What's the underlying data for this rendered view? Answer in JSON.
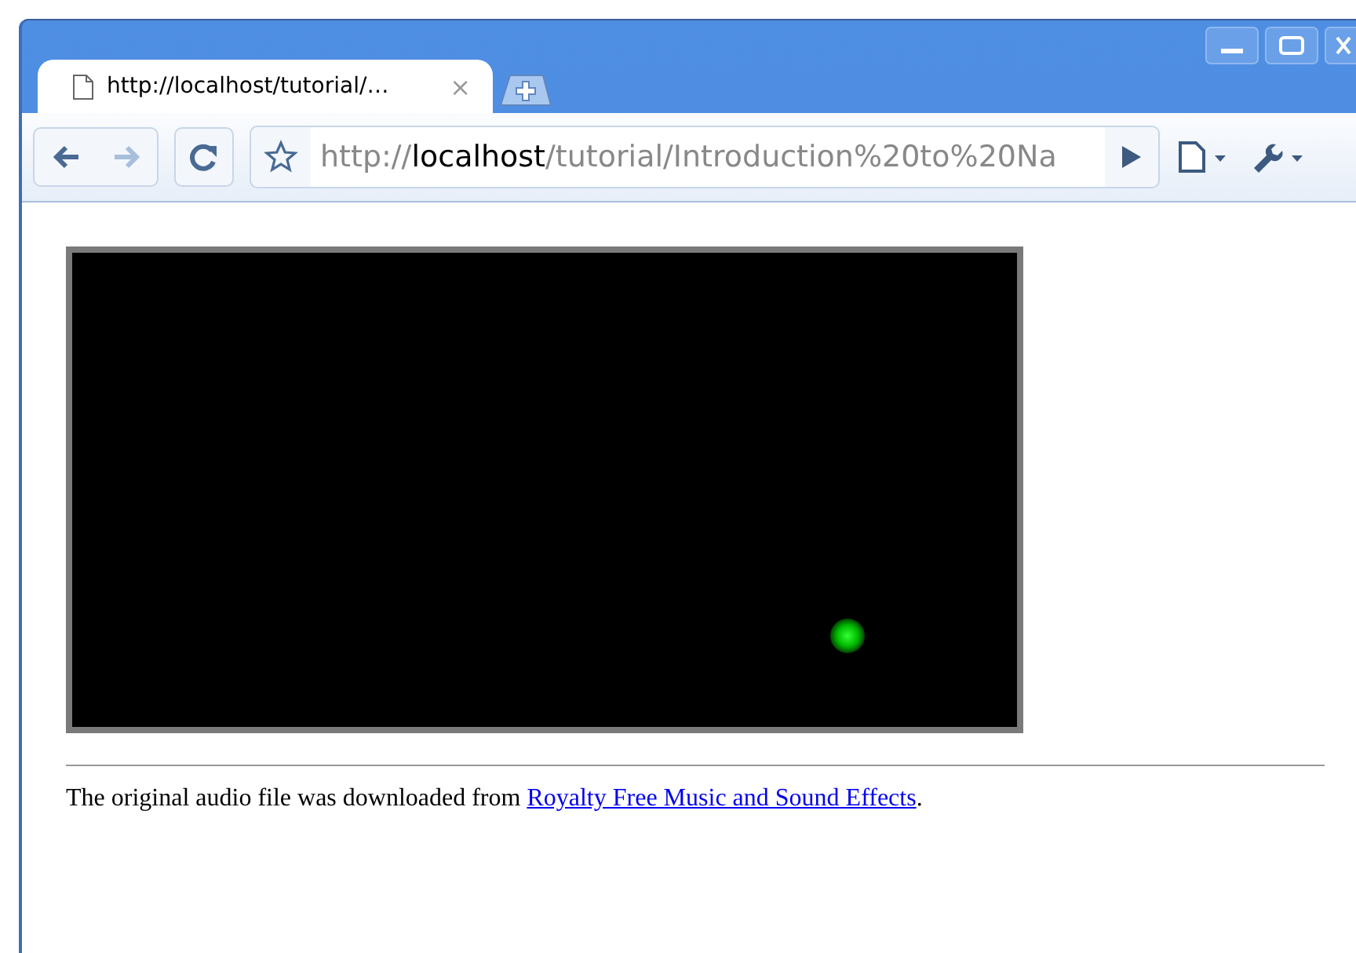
{
  "tabs": [
    {
      "title": "http://localhost/tutorial/…",
      "close": "×",
      "selected": true
    }
  ],
  "address": {
    "scheme": "http://",
    "host": "localhost",
    "path": "/tutorial/Introduction%20to%20Na"
  },
  "footer": {
    "text": "The original audio file was downloaded from ",
    "link": "Royalty Free Music and Sound Effects",
    "after": "."
  }
}
